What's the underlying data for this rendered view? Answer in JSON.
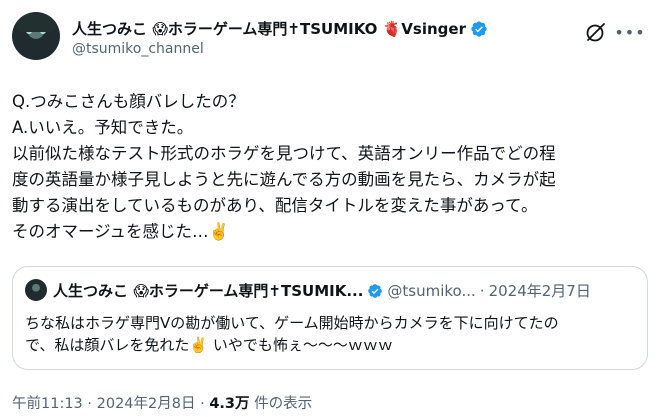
{
  "author": {
    "display_name": "人生つみこ 😱ホラーゲーム専門✝TSUMIKO 🫀Vsinger",
    "handle": "@tsumiko_channel"
  },
  "post": {
    "lines": [
      "Q.つみこさんも顔バレしたの？",
      "A.いいえ。予知できた。",
      "以前似た様なテスト形式のホラゲを見つけて、英語オンリー作品でどの程",
      "度の英語量か様子見しようと先に遊んでる方の動画を見たら、カメラが起",
      "動する演出をしているものがあり、配信タイトルを変えた事があって。",
      "そのオマージュを感じた…✌️"
    ]
  },
  "quote": {
    "display_name": "人生つみこ 😱ホラーゲーム専門✝TSUMIK...",
    "handle": "@tsumiko...",
    "separator": "·",
    "date": "2024年2月7日",
    "lines": [
      "ちな私はホラゲ専門Vの勘が働いて、ゲーム開始時からカメラを下に向けてたの",
      "で、私は顔バレを免れた✌️ いやでも怖ぇ～～～ｗｗｗ"
    ]
  },
  "meta": {
    "time": "午前11:13",
    "sep1": " · ",
    "date": "2024年2月8日",
    "sep2": " · ",
    "views": "4.3万",
    "views_label": " 件の表示"
  },
  "colors": {
    "verified": "#1d9bf0",
    "secondary_text": "#536471",
    "border": "#cfd9de"
  },
  "icons": {
    "verified": "verified-badge-icon",
    "grok": "grok-icon",
    "more": "more-icon"
  }
}
